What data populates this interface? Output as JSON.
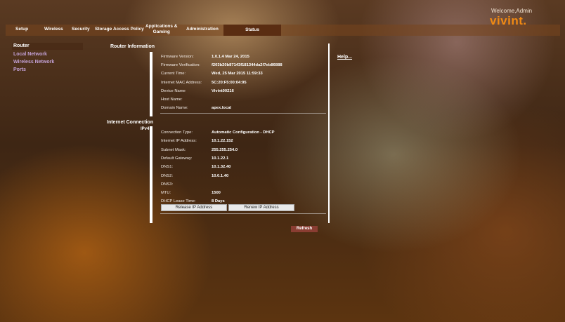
{
  "header": {
    "welcome_text": "Welcome,Admin",
    "logo_text": "vivint."
  },
  "nav": {
    "setup": "Setup",
    "wireless": "Wireless",
    "security": "Security",
    "storage": "Storage",
    "access_policy": "Access Policy",
    "applications_gaming_line1": "Applications &",
    "applications_gaming_line2": "Gaming",
    "administration": "Administration",
    "status": "Status"
  },
  "sidebar": {
    "items": [
      {
        "label": "Router"
      },
      {
        "label": "Local Network"
      },
      {
        "label": "Wireless Network"
      },
      {
        "label": "Ports"
      }
    ]
  },
  "sections": {
    "router_information": "Router Information",
    "internet_connection": "Internet Connection",
    "ipv4": "IPv4"
  },
  "router_info": [
    {
      "label": "Firmware Version:",
      "value": "1.0.1.4  Mar 24, 2015"
    },
    {
      "label": "Firmware Verification:",
      "value": "f203b20b87143f181344da2f7eb86888"
    },
    {
      "label": "Current Time:",
      "value": "Wed, 25 Mar 2015 11:59:33"
    },
    {
      "label": "Internet MAC Address:",
      "value": "5C:20:F5:00:04:95"
    },
    {
      "label": "Device Name",
      "value": "Vivint00216"
    },
    {
      "label": "Host Name:",
      "value": ""
    },
    {
      "label": "Domain Name:",
      "value": "apex.local"
    }
  ],
  "internet_info": [
    {
      "label": "Connection Type:",
      "value": "Automatic Configuration - DHCP"
    },
    {
      "label": "Internet IP Address:",
      "value": "10.1.22.152"
    },
    {
      "label": "Subnet Mask:",
      "value": "255.255.254.0"
    },
    {
      "label": "Default Gateway:",
      "value": "10.1.22.1"
    },
    {
      "label": "DNS1:",
      "value": "10.1.32.40"
    },
    {
      "label": "DNS2:",
      "value": "10.0.1.40"
    },
    {
      "label": "DNS3:",
      "value": ""
    },
    {
      "label": "MTU:",
      "value": "1500"
    },
    {
      "label": "DHCP Lease Time:",
      "value": "8 Days"
    }
  ],
  "buttons": {
    "release_ip": "Release IP Address",
    "renew_ip": "Renew IP Address",
    "refresh": "Refresh"
  },
  "help": {
    "label": "Help..."
  },
  "colors": {
    "accent_orange": "#f28a12",
    "active_tab": "#5a2d12",
    "refresh_button": "#8a3d32",
    "sidebar_link": "#c3a1d6"
  }
}
